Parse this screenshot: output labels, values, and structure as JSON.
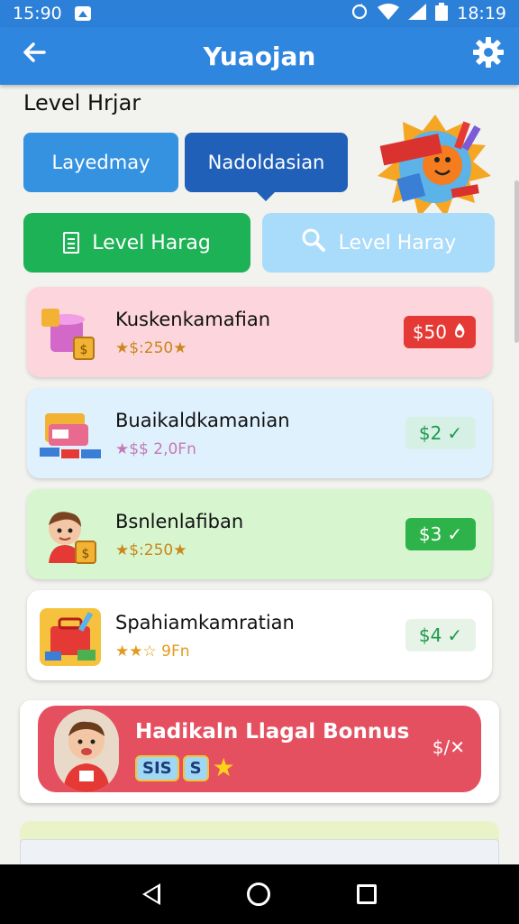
{
  "status_bar": {
    "time_left": "15:90",
    "time_right": "18:19"
  },
  "app_bar": {
    "title": "Yuaojan",
    "back_icon": "arrow-left-icon",
    "settings_icon": "gear-icon"
  },
  "section_title": "Level Hrjar",
  "tabs": [
    {
      "label": "Layedmay",
      "selected": false
    },
    {
      "label": "Nadoldasian",
      "selected": true
    }
  ],
  "actions": {
    "primary": {
      "label": "Level Harag",
      "icon": "document-icon",
      "color": "#1eb256"
    },
    "secondary": {
      "label": "Level Haray",
      "icon": "search-icon",
      "color": "#a9dbfa"
    }
  },
  "items": [
    {
      "name": "Kuskenkamafian",
      "stars_text": "★$:250★",
      "price": "$50",
      "price_icon": "flame-icon",
      "bg": "#fcd6dc",
      "price_bg": "#e53935",
      "price_fg": "#ffffff"
    },
    {
      "name": "Buaikaldkamanian",
      "stars_text": "★$$ 2,0Fn",
      "price": "$2",
      "price_icon": "check-icon",
      "bg": "#dff1fc",
      "price_bg": "#d7f0e6",
      "price_fg": "#1d9a4c"
    },
    {
      "name": "Bsnlenlafiban",
      "stars_text": "★$:250★",
      "price": "$3",
      "price_icon": "check-icon",
      "bg": "#d7f6cf",
      "price_bg": "#2eb34a",
      "price_fg": "#ffffff"
    },
    {
      "name": "Spahiamkamratian",
      "stars_text": "★★☆ 9Fn",
      "price": "$4",
      "price_icon": "check-icon",
      "bg": "#ffffff",
      "price_bg": "#e6f3e6",
      "price_fg": "#1d9a4c"
    }
  ],
  "bonus": {
    "title": "Hadikaln Llagal Bonnus",
    "tag": "SIS",
    "tag2": "S",
    "action_text": "$/✕"
  }
}
